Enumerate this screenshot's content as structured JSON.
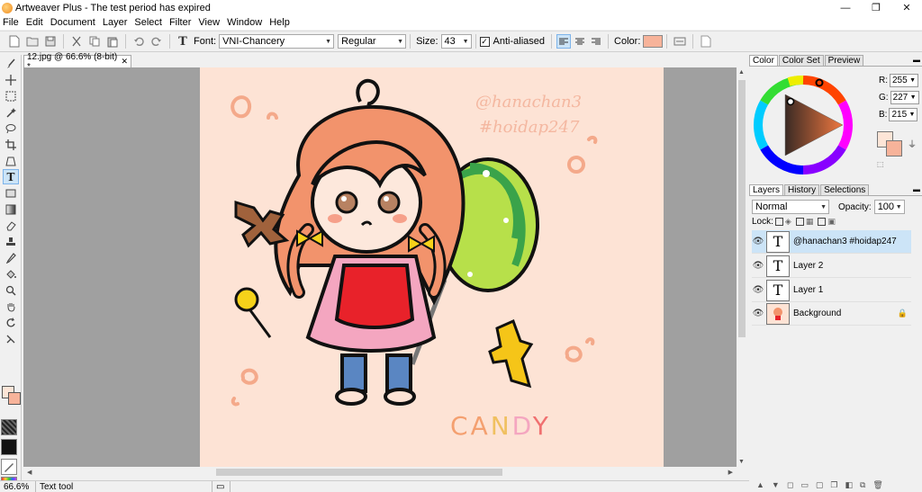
{
  "window": {
    "title": "Artweaver Plus - The test period has expired",
    "minimize": "—",
    "maximize": "❐",
    "close": "✕"
  },
  "menu": [
    "File",
    "Edit",
    "Document",
    "Layer",
    "Select",
    "Filter",
    "View",
    "Window",
    "Help"
  ],
  "options": {
    "font_label": "Font:",
    "font_value": "VNI-Chancery",
    "style_value": "Regular",
    "size_label": "Size:",
    "size_value": "43",
    "antialias_label": "Anti-aliased",
    "antialias_checked": "✓",
    "color_label": "Color:",
    "color_value": "#f7b39a"
  },
  "document": {
    "tab_title": "12.jpg @ 66.6% (8-bit) *",
    "tab_close": "✕",
    "canvas_bg": "#fde3d5",
    "watermark_line1": "@hanachan3",
    "watermark_line2": "#hoidap247",
    "candy_text": "CANDY"
  },
  "status": {
    "zoom": "66.6%",
    "tool": "Text tool"
  },
  "color_panel": {
    "tabs": [
      "Color",
      "Color Set",
      "Preview"
    ],
    "r_label": "R:",
    "r_value": "255",
    "g_label": "G:",
    "g_value": "227",
    "b_label": "B:",
    "b_value": "215",
    "fg_color": "#fde5d7",
    "bg_color": "#f7b39a"
  },
  "layers_panel": {
    "tabs": [
      "Layers",
      "History",
      "Selections"
    ],
    "blend_mode": "Normal",
    "opacity_label": "Opacity:",
    "opacity_value": "100",
    "lock_label": "Lock:",
    "layers": [
      {
        "name": "@hanachan3 #hoidap247",
        "type": "text",
        "thumb": "T"
      },
      {
        "name": "Layer 2",
        "type": "text",
        "thumb": "T"
      },
      {
        "name": "Layer 1",
        "type": "text",
        "thumb": "T"
      },
      {
        "name": "Background",
        "type": "image",
        "thumb": ""
      }
    ]
  }
}
